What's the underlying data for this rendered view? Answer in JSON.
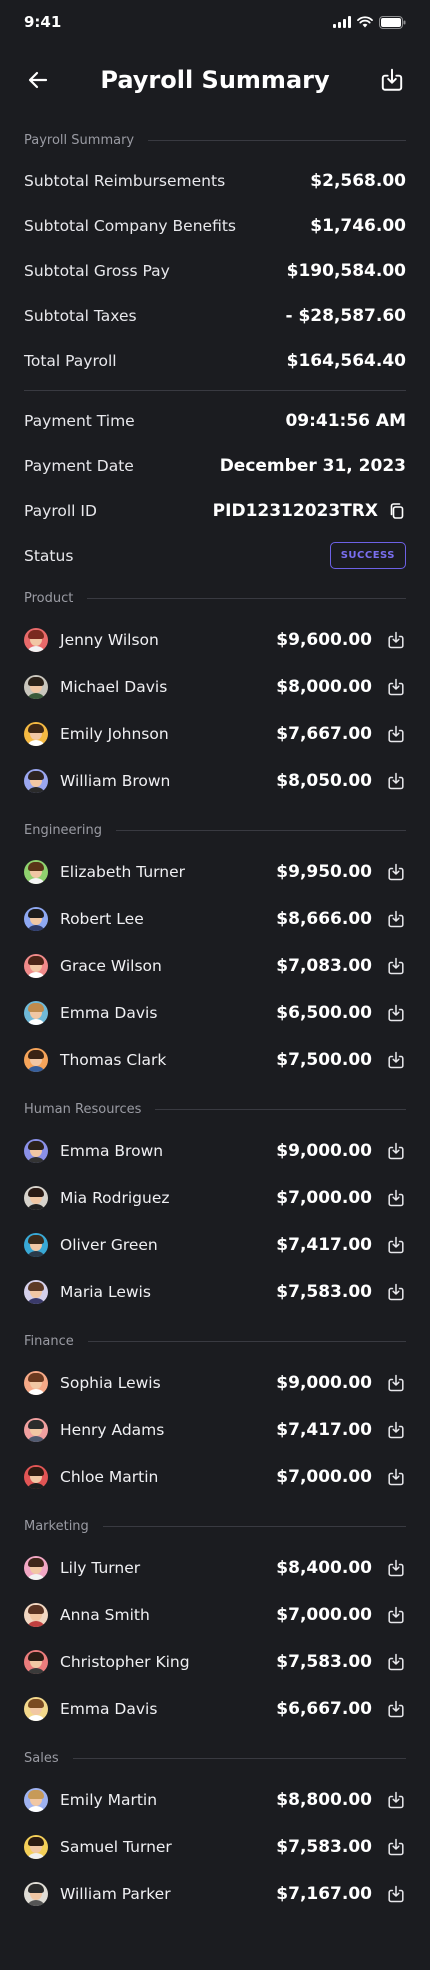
{
  "status": {
    "time": "9:41"
  },
  "header": {
    "title": "Payroll Summary"
  },
  "summary": {
    "section_label": "Payroll Summary",
    "rows": [
      {
        "label": "Subtotal Reimbursements",
        "value": "$2,568.00"
      },
      {
        "label": "Subtotal Company Benefits",
        "value": "$1,746.00"
      },
      {
        "label": "Subtotal Gross Pay",
        "value": "$190,584.00"
      },
      {
        "label": "Subtotal Taxes",
        "value": "- $28,587.60"
      },
      {
        "label": "Total Payroll",
        "value": "$164,564.40"
      }
    ]
  },
  "payment": {
    "time_label": "Payment Time",
    "time_value": "09:41:56 AM",
    "date_label": "Payment Date",
    "date_value": "December 31, 2023",
    "id_label": "Payroll ID",
    "id_value": "PID12312023TRX",
    "status_label": "Status",
    "status_value": "SUCCESS"
  },
  "departments": [
    {
      "name": "Product",
      "employees": [
        {
          "name": "Jenny Wilson",
          "amount": "$9,600.00",
          "bg": "#e86a6a",
          "hair": "#7a2a1f",
          "shirt": "#f2f2f2"
        },
        {
          "name": "Michael Davis",
          "amount": "$8,000.00",
          "bg": "#c9c6bd",
          "hair": "#2b2118",
          "shirt": "#3a5a3a"
        },
        {
          "name": "Emily Johnson",
          "amount": "$7,667.00",
          "bg": "#f4b942",
          "hair": "#3d2716",
          "shirt": "#ffffff"
        },
        {
          "name": "William Brown",
          "amount": "$8,050.00",
          "bg": "#9aa6f0",
          "hair": "#2d2422",
          "shirt": "#2a2a2a"
        }
      ]
    },
    {
      "name": "Engineering",
      "employees": [
        {
          "name": "Elizabeth Turner",
          "amount": "$9,950.00",
          "bg": "#8fd16e",
          "hair": "#5a3418",
          "shirt": "#f5f5f5"
        },
        {
          "name": "Robert Lee",
          "amount": "$8,666.00",
          "bg": "#8ea8f2",
          "hair": "#1f1c1c",
          "shirt": "#2f3b6a"
        },
        {
          "name": "Grace Wilson",
          "amount": "$7,083.00",
          "bg": "#f08a8a",
          "hair": "#4a2416",
          "shirt": "#ffffff"
        },
        {
          "name": "Emma Davis",
          "amount": "$6,500.00",
          "bg": "#6fb9d8",
          "hair": "#c08b4c",
          "shirt": "#ffffff"
        },
        {
          "name": "Thomas Clark",
          "amount": "$7,500.00",
          "bg": "#f5a45a",
          "hair": "#3a2314",
          "shirt": "#355e9c"
        }
      ]
    },
    {
      "name": "Human Resources",
      "employees": [
        {
          "name": "Emma Brown",
          "amount": "$9,000.00",
          "bg": "#8a90e8",
          "hair": "#2a211b",
          "shirt": "#333333"
        },
        {
          "name": "Mia Rodriguez",
          "amount": "$7,000.00",
          "bg": "#d7d3cc",
          "hair": "#2a1a14",
          "shirt": "#222222"
        },
        {
          "name": "Oliver Green",
          "amount": "$7,417.00",
          "bg": "#39a9d6",
          "hair": "#3b2a1b",
          "shirt": "#2a3a4a"
        },
        {
          "name": "Maria Lewis",
          "amount": "$7,583.00",
          "bg": "#d5d0ea",
          "hair": "#5c3a26",
          "shirt": "#3a3a6a"
        }
      ]
    },
    {
      "name": "Finance",
      "employees": [
        {
          "name": "Sophia Lewis",
          "amount": "$9,000.00",
          "bg": "#f6a987",
          "hair": "#6b3a20",
          "shirt": "#ffffff"
        },
        {
          "name": "Henry Adams",
          "amount": "$7,417.00",
          "bg": "#f0a0a0",
          "hair": "#2b2b2b",
          "shirt": "#505a70"
        },
        {
          "name": "Chloe Martin",
          "amount": "$7,000.00",
          "bg": "#e25555",
          "hair": "#2e1b12",
          "shirt": "#1e1e1e"
        }
      ]
    },
    {
      "name": "Marketing",
      "employees": [
        {
          "name": "Lily Turner",
          "amount": "$8,400.00",
          "bg": "#f2a7c4",
          "hair": "#3f2619",
          "shirt": "#f2f2f2"
        },
        {
          "name": "Anna Smith",
          "amount": "$7,000.00",
          "bg": "#f2d7c2",
          "hair": "#5a3322",
          "shirt": "#c04040"
        },
        {
          "name": "Christopher King",
          "amount": "$7,583.00",
          "bg": "#ea7c7c",
          "hair": "#2a1c14",
          "shirt": "#3a3a3a"
        },
        {
          "name": "Emma Davis",
          "amount": "$6,667.00",
          "bg": "#f3d88c",
          "hair": "#7a4a22",
          "shirt": "#ffffff"
        }
      ]
    },
    {
      "name": "Sales",
      "employees": [
        {
          "name": "Emily Martin",
          "amount": "$8,800.00",
          "bg": "#9fb2f0",
          "hair": "#c79a58",
          "shirt": "#ffffff"
        },
        {
          "name": "Samuel Turner",
          "amount": "$7,583.00",
          "bg": "#f4cf58",
          "hair": "#2b1b12",
          "shirt": "#f0f0f0"
        },
        {
          "name": "William Parker",
          "amount": "$7,167.00",
          "bg": "#e0ddd6",
          "hair": "#2b2b2b",
          "shirt": "#555555"
        }
      ]
    }
  ]
}
